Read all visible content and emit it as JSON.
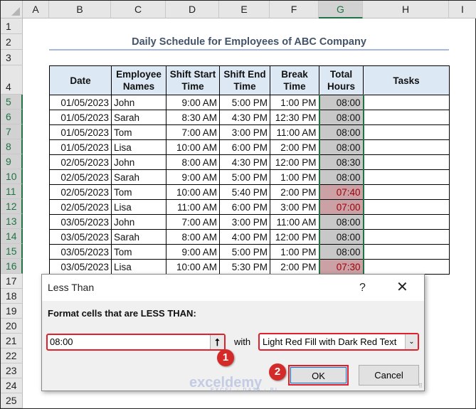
{
  "columns": [
    "A",
    "B",
    "C",
    "D",
    "E",
    "F",
    "G",
    "H",
    "I"
  ],
  "rows": [
    "1",
    "2",
    "3",
    "4",
    "5",
    "6",
    "7",
    "8",
    "9",
    "10",
    "11",
    "12",
    "13",
    "14",
    "15",
    "16",
    "17",
    "18",
    "19",
    "20",
    "21",
    "22",
    "23",
    "24",
    "25"
  ],
  "title": "Daily Schedule for Employees of ABC Company",
  "headers": [
    "Date",
    "Employee Names",
    "Shift Start Time",
    "Shift End Time",
    "Break Time",
    "Total Hours",
    "Tasks"
  ],
  "data": [
    [
      "01/05/2023",
      "John",
      "9:00 AM",
      "5:00 PM",
      "1:00 PM",
      "08:00",
      ""
    ],
    [
      "01/05/2023",
      "Sarah",
      "8:30 AM",
      "4:30 PM",
      "12:30 PM",
      "08:00",
      ""
    ],
    [
      "01/05/2023",
      "Tom",
      "7:00 AM",
      "3:00 PM",
      "11:00 AM",
      "08:00",
      ""
    ],
    [
      "01/05/2023",
      "Lisa",
      "10:00 AM",
      "6:00 PM",
      "2:00 PM",
      "08:00",
      ""
    ],
    [
      "02/05/2023",
      "John",
      "8:00 AM",
      "4:30 PM",
      "12:00 PM",
      "08:30",
      ""
    ],
    [
      "02/05/2023",
      "Sarah",
      "9:00 AM",
      "5:00 PM",
      "1:00 PM",
      "08:00",
      ""
    ],
    [
      "02/05/2023",
      "Tom",
      "10:00 AM",
      "5:40 PM",
      "2:00 PM",
      "07:40",
      ""
    ],
    [
      "02/05/2023",
      "Lisa",
      "11:00 AM",
      "6:00 PM",
      "3:00 PM",
      "07:00",
      ""
    ],
    [
      "03/05/2023",
      "John",
      "7:00 AM",
      "3:00 PM",
      "11:00 AM",
      "08:00",
      ""
    ],
    [
      "03/05/2023",
      "Sarah",
      "8:00 AM",
      "4:00 PM",
      "12:00 PM",
      "08:00",
      ""
    ],
    [
      "03/05/2023",
      "Tom",
      "9:00 AM",
      "5:00 PM",
      "1:00 PM",
      "08:00",
      ""
    ],
    [
      "03/05/2023",
      "Lisa",
      "10:00 AM",
      "5:30 PM",
      "2:00 PM",
      "07:30",
      ""
    ]
  ],
  "highlight_rows": [
    6,
    7,
    11
  ],
  "colors": {
    "accent": "#217346",
    "low_fill": "#cba1a5",
    "low_text": "#9c0006",
    "header_fill": "#dde8f5",
    "annotation": "#e0202a"
  },
  "dialog": {
    "title": "Less Than",
    "help": "?",
    "close": "✕",
    "prompt": "Format cells that are LESS THAN:",
    "value": "08:00",
    "ref_icon": "⭡",
    "with": "with",
    "format": "Light Red Fill with Dark Red Text",
    "ok": "OK",
    "cancel": "Cancel"
  },
  "badges": [
    "1",
    "2"
  ],
  "watermark": {
    "name": "exceldemy",
    "tagline": "EXCEL · DATA · BI"
  }
}
